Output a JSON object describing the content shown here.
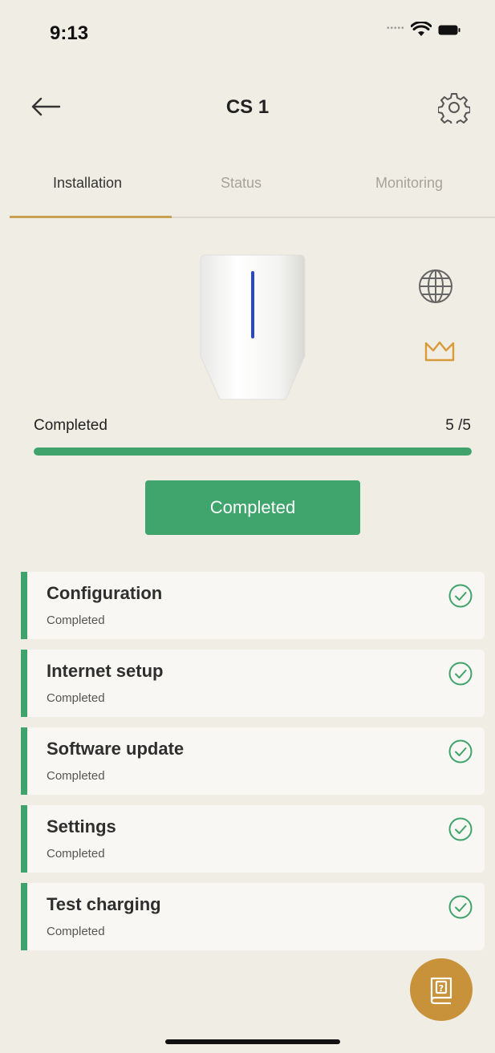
{
  "status_bar": {
    "time": "9:13"
  },
  "header": {
    "title": "CS 1"
  },
  "tabs": [
    {
      "label": "Installation",
      "active": true
    },
    {
      "label": "Status",
      "active": false
    },
    {
      "label": "Monitoring",
      "active": false
    }
  ],
  "progress": {
    "label": "Completed",
    "count_text": "5 /5",
    "fraction": 1.0
  },
  "action_button": {
    "label": "Completed"
  },
  "steps": [
    {
      "title": "Configuration",
      "status": "Completed"
    },
    {
      "title": "Internet setup",
      "status": "Completed"
    },
    {
      "title": "Software update",
      "status": "Completed"
    },
    {
      "title": "Settings",
      "status": "Completed"
    },
    {
      "title": "Test charging",
      "status": "Completed"
    }
  ],
  "colors": {
    "background": "#f0ede4",
    "accent_gold": "#c8a150",
    "success_green": "#3fa36b",
    "fab": "#c8923a"
  },
  "icons": {
    "back": "arrow-left-icon",
    "settings": "gear-icon",
    "network": "globe-icon",
    "premium": "crown-icon",
    "step_done": "check-circle-icon",
    "help": "manual-book-icon"
  }
}
